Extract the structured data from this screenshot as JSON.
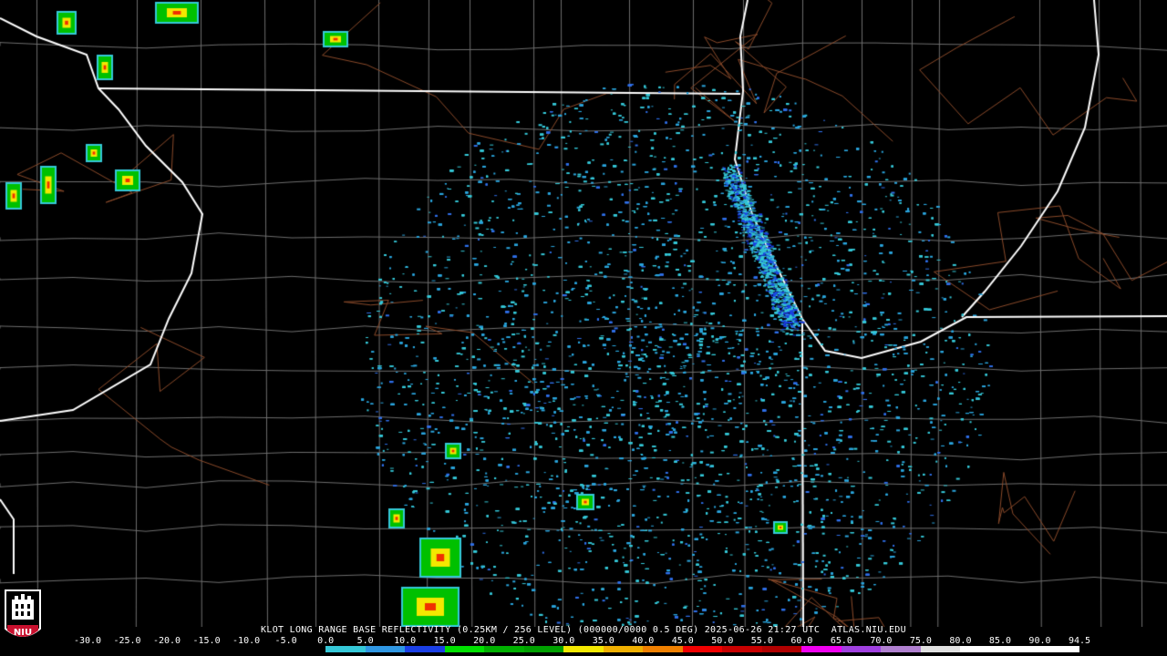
{
  "map": {
    "radar_site": "KLOT",
    "caption": "KLOT LONG RANGE BASE REFLECTIVITY (0.25KM / 256 LEVEL) (000000/0000 0.5 DEG) 2025-06-26 21:27 UTC  ATLAS.NIU.EDU",
    "logo_text": "NIU"
  },
  "legend": {
    "labels": [
      "-30.0",
      "-25.0",
      "-20.0",
      "-15.0",
      "-10.0",
      "-5.0",
      "0.0",
      "5.0",
      "10.0",
      "15.0",
      "20.0",
      "25.0",
      "30.0",
      "35.0",
      "40.0",
      "45.0",
      "50.0",
      "55.0",
      "60.0",
      "65.0",
      "70.0",
      "75.0",
      "80.0",
      "85.0",
      "90.0",
      "94.5"
    ],
    "colors": [
      "#000000",
      "#000000",
      "#000000",
      "#000000",
      "#000000",
      "#000000",
      "#35c8d8",
      "#2f97e3",
      "#1a3fe6",
      "#00e000",
      "#00b000",
      "#00a000",
      "#f3e800",
      "#f0b000",
      "#f08000",
      "#f00000",
      "#c80000",
      "#b00000",
      "#f000f0",
      "#a040e0",
      "#b080d0",
      "#e0e0e0",
      "#ffffff",
      "#ffffff",
      "#ffffff"
    ]
  }
}
